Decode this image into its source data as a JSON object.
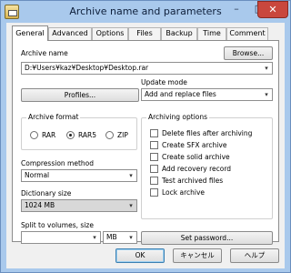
{
  "window": {
    "title": "Archive name and parameters",
    "minimize": "–",
    "maximize": "□",
    "close": "✕",
    "app_icon": "winrar-icon"
  },
  "tabs": [
    {
      "label": "General",
      "active": true
    },
    {
      "label": "Advanced"
    },
    {
      "label": "Options"
    },
    {
      "label": "Files"
    },
    {
      "label": "Backup"
    },
    {
      "label": "Time"
    },
    {
      "label": "Comment"
    }
  ],
  "archive": {
    "name_label": "Archive name",
    "browse_label": "Browse...",
    "name_value": "D:¥Users¥kaz¥Desktop¥Desktop.rar"
  },
  "profiles_label": "Profiles...",
  "update_mode": {
    "label": "Update mode",
    "value": "Add and replace files"
  },
  "archive_format": {
    "title": "Archive format",
    "options": [
      {
        "label": "RAR",
        "selected": false
      },
      {
        "label": "RAR5",
        "selected": true
      },
      {
        "label": "ZIP",
        "selected": false
      }
    ]
  },
  "compression": {
    "label": "Compression method",
    "value": "Normal"
  },
  "dictionary": {
    "label": "Dictionary size",
    "value": "1024 MB"
  },
  "split": {
    "label": "Split to volumes, size",
    "value": "",
    "unit": "MB"
  },
  "archiving_options": {
    "title": "Archiving options",
    "items": [
      {
        "label": "Delete files after archiving",
        "checked": false
      },
      {
        "label": "Create SFX archive",
        "checked": false
      },
      {
        "label": "Create solid archive",
        "checked": false
      },
      {
        "label": "Add recovery record",
        "checked": false
      },
      {
        "label": "Test archived files",
        "checked": false
      },
      {
        "label": "Lock archive",
        "checked": false
      }
    ]
  },
  "set_password_label": "Set password...",
  "footer": {
    "ok": "OK",
    "cancel": "キャンセル",
    "help": "ヘルプ"
  },
  "colors": {
    "title_bg": "#a9c9ec",
    "close_btn": "#c9473d",
    "dialog_bg": "#f0f0f0"
  }
}
